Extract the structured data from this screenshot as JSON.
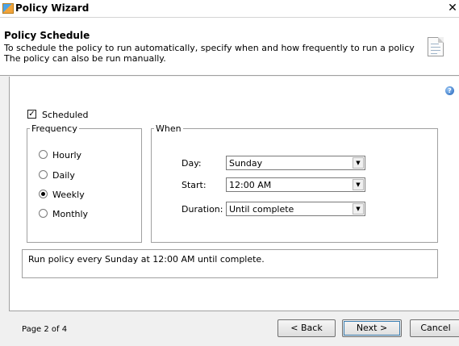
{
  "window": {
    "title": "Policy Wizard",
    "close_glyph": "✕"
  },
  "header": {
    "title": "Policy Schedule",
    "line1": "To schedule the policy to run automatically, specify when and how frequently to run a policy",
    "line2": "The policy can also be run manually."
  },
  "help_icon_glyph": "?",
  "scheduled": {
    "label": "Scheduled",
    "checked": true,
    "mark": "✓"
  },
  "frequency": {
    "legend": "Frequency",
    "options": [
      {
        "label": "Hourly",
        "selected": false
      },
      {
        "label": "Daily",
        "selected": false
      },
      {
        "label": "Weekly",
        "selected": true
      },
      {
        "label": "Monthly",
        "selected": false
      }
    ]
  },
  "when": {
    "legend": "When",
    "day": {
      "label": "Day:",
      "value": "Sunday"
    },
    "start": {
      "label": "Start:",
      "value": "12:00 AM"
    },
    "duration": {
      "label": "Duration:",
      "value": "Until complete"
    },
    "arrow_glyph": "▼"
  },
  "summary": "Run policy every Sunday at 12:00 AM until complete.",
  "footer": {
    "page_indicator": "Page 2 of 4",
    "back": "< Back",
    "next": "Next >",
    "cancel": "Cancel"
  }
}
